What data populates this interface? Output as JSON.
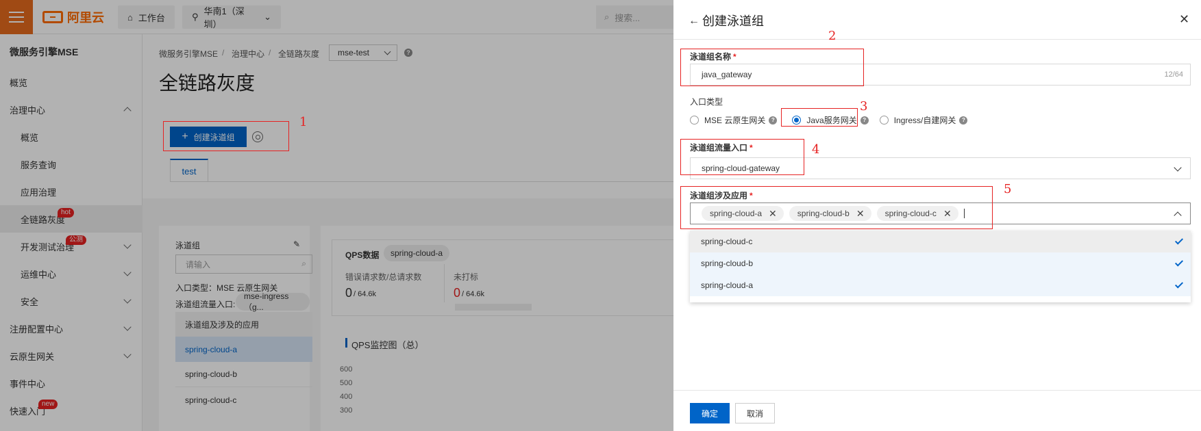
{
  "topbar": {
    "logo_text": "阿里云",
    "workbench": "工作台",
    "region": "华南1（深圳）",
    "search_placeholder": "搜索..."
  },
  "sidebar": {
    "title": "微服务引擎MSE",
    "items": [
      {
        "label": "概览"
      },
      {
        "label": "治理中心"
      },
      {
        "label": "概览"
      },
      {
        "label": "服务查询"
      },
      {
        "label": "应用治理"
      },
      {
        "label": "全链路灰度",
        "badge": "hot"
      },
      {
        "label": "开发测试治理",
        "badge": "公测"
      },
      {
        "label": "运维中心"
      },
      {
        "label": "安全"
      },
      {
        "label": "注册配置中心"
      },
      {
        "label": "云原生网关"
      },
      {
        "label": "事件中心"
      },
      {
        "label": "快速入门",
        "badge": "new"
      }
    ]
  },
  "main": {
    "breadcrumb": [
      "微服务引擎MSE",
      "治理中心",
      "全链路灰度"
    ],
    "breadcrumb_sep": "/",
    "namespace": "mse-test",
    "page_title": "全链路灰度",
    "create_label": "创建泳道组",
    "tab": "test",
    "lane_panel": {
      "title": "泳道组",
      "search_placeholder": "请输入",
      "entry_type": "入口类型：MSE 云原生网关",
      "traffic_entry_label": "泳道组流量入口:",
      "traffic_entry_value": "mse-ingress（g...",
      "apps_header": "泳道组及涉及的应用",
      "apps": [
        "spring-cloud-a",
        "spring-cloud-b",
        "spring-cloud-c"
      ]
    },
    "qps": {
      "title": "QPS数据",
      "tag": "spring-cloud-a",
      "err_label": "错误请求数/总请求数",
      "err_value": "0",
      "err_total": "/ 64.6k",
      "untagged_label": "未打标",
      "untagged_value": "0",
      "untagged_total": "/ 64.6k",
      "chart_title": "QPS监控图（总）",
      "y_ticks": [
        "600",
        "500",
        "400",
        "300"
      ]
    }
  },
  "drawer": {
    "back": "←",
    "title": "创建泳道组",
    "close": "✕",
    "name_label": "泳道组名称",
    "required_mark": "*",
    "name_value": "java_gateway",
    "name_counter": "12/64",
    "entry_type_label": "入口类型",
    "entry_types": [
      {
        "label": "MSE 云原生网关",
        "checked": false
      },
      {
        "label": "Java服务网关",
        "checked": true
      },
      {
        "label": "Ingress/自建网关",
        "checked": false
      }
    ],
    "traffic_label": "泳道组流量入口",
    "traffic_value": "spring-cloud-gateway",
    "apps_label": "泳道组涉及应用",
    "apps_tags": [
      "spring-cloud-a",
      "spring-cloud-b",
      "spring-cloud-c"
    ],
    "dropdown_options": [
      "spring-cloud-c",
      "spring-cloud-b",
      "spring-cloud-a"
    ],
    "ok": "确定",
    "cancel": "取消"
  },
  "annotations": [
    "1",
    "2",
    "3",
    "4",
    "5"
  ],
  "colors": {
    "accent": "#0064c8",
    "brand": "#ff6a00",
    "annotation": "#e62222"
  }
}
